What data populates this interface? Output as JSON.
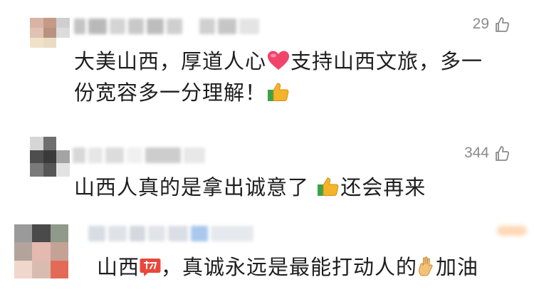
{
  "comments": [
    {
      "likes": "29",
      "text_line1_a": "大美山西，厚道人心",
      "text_line1_b": "支持山西文旅，多一",
      "text_line2": "份宽容多一分理解！",
      "emojis": [
        "heart-emoji",
        "thumbs-up-emoji"
      ]
    },
    {
      "likes": "344",
      "text_a": "山西人真的是拿出诚意了",
      "text_b": "还会再来",
      "emojis": [
        "thumbs-up-emoji"
      ]
    },
    {
      "text_a": "山西",
      "text_b": "，真诚永远是最能打动人的",
      "text_c": "加油",
      "emojis": [
        "cheer-sticker-emoji",
        "ok-hand-emoji"
      ]
    }
  ],
  "colors": {
    "text": "#1e1e1e",
    "meta": "#8a8a8a",
    "heart": "#f0446a",
    "thumbs": "#f5b428",
    "cuff": "#3aa34a"
  }
}
